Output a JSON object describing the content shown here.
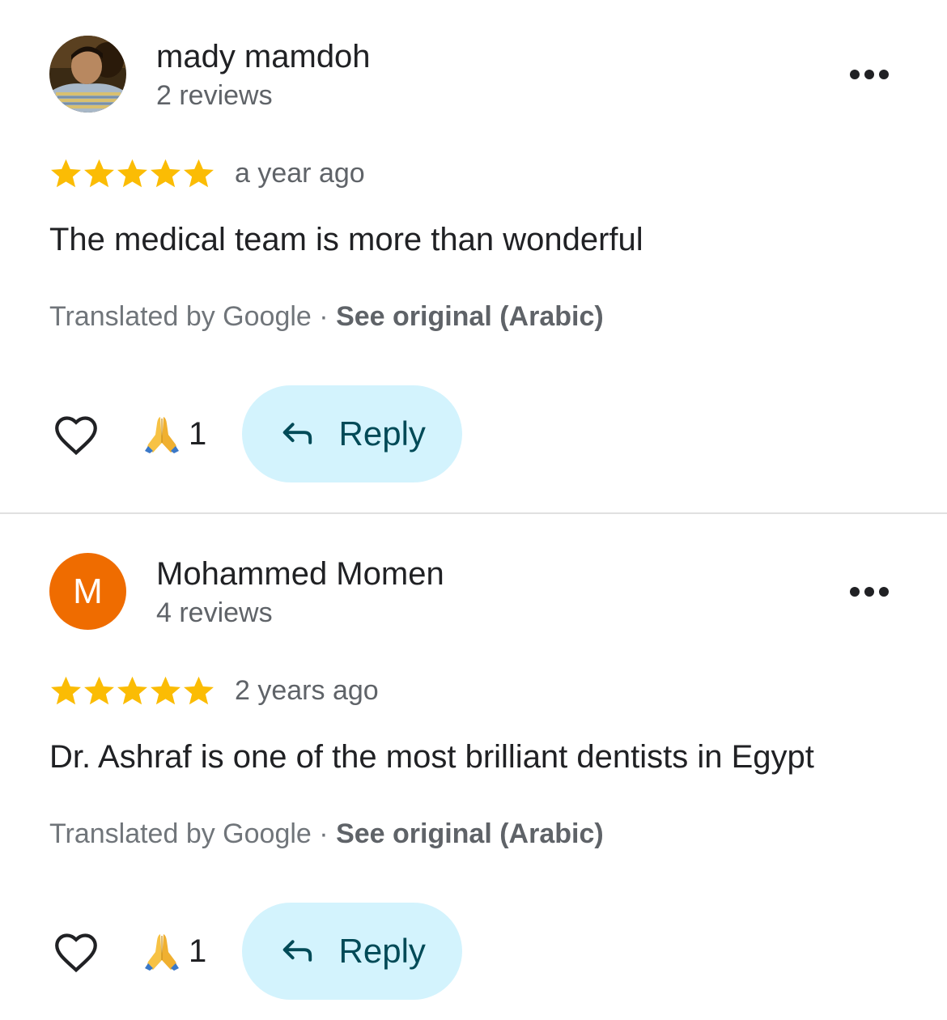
{
  "colors": {
    "star": "#fbbc04",
    "avatar_letter_bg": "#ef6c00",
    "reply_bg": "#d3f3fd",
    "reply_text": "#004a57",
    "secondary_text": "#5f6368"
  },
  "reviews": [
    {
      "author": "mady mamdoh",
      "review_count": "2 reviews",
      "avatar": "photo",
      "rating": 5,
      "date": "a year ago",
      "text": "The medical team is more than wonderful",
      "translated_by": "Translated by Google",
      "separator": "·",
      "see_original": "See original (Arabic)",
      "reaction_emoji": "🙏",
      "reaction_count": "1",
      "reply_label": "Reply"
    },
    {
      "author": "Mohammed Momen",
      "review_count": "4 reviews",
      "avatar_letter": "M",
      "rating": 5,
      "date": "2 years ago",
      "text": "Dr. Ashraf is one of the most brilliant dentists in Egypt",
      "translated_by": "Translated by Google",
      "separator": "·",
      "see_original": "See original (Arabic)",
      "reaction_emoji": "🙏",
      "reaction_count": "1",
      "reply_label": "Reply"
    }
  ]
}
